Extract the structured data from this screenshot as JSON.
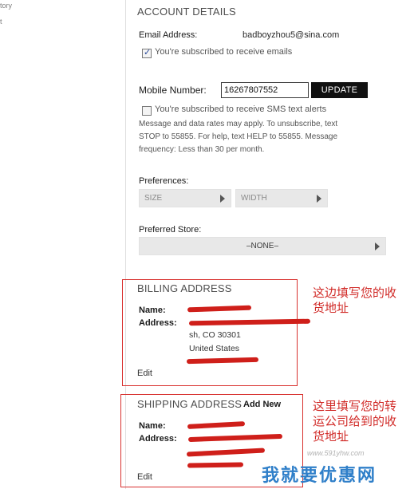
{
  "sidebar": {
    "items": [
      "tory",
      "t"
    ]
  },
  "account": {
    "title": "ACCOUNT DETAILS",
    "email_label": "Email Address:",
    "email_value": "badboyzhou5@sina.com",
    "email_subscribe": "You're subscribed to receive emails",
    "email_subscribed": true,
    "mobile_label": "Mobile Number:",
    "mobile_value": "16267807552",
    "update_label": "UPDATE",
    "sms_subscribe": "You're subscribed to receive SMS text alerts",
    "sms_subscribed": false,
    "sms_notice_1": "Message and data rates may apply. To unsubscribe, text",
    "sms_notice_2": "STOP to 55855. For help, text HELP to 55855. Message",
    "sms_notice_3": "frequency: Less than 30 per month.",
    "preferences_label": "Preferences:",
    "size_option": "SIZE",
    "width_option": "WIDTH",
    "preferred_store_label": "Preferred Store:",
    "store_option": "–NONE–"
  },
  "billing": {
    "title": "BILLING ADDRESS",
    "name_label": "Name:",
    "address_label": "Address:",
    "city_line": "sh, CO 30301",
    "country_line": "United States",
    "edit_label": "Edit",
    "note_line_1": "这边填写您的收",
    "note_line_2": "货地址"
  },
  "shipping": {
    "title": "SHIPPING ADDRESS",
    "add_new_label": "Add New",
    "name_label": "Name:",
    "address_label": "Address:",
    "edit_label": "Edit",
    "note_line_1": "这里填写您的转",
    "note_line_2": "运公司给到的收",
    "note_line_3": "货地址"
  },
  "watermark": {
    "text": "我就要优惠网",
    "url": "www.591yhw.com"
  },
  "colors": {
    "annotation_red": "#d12b28",
    "button_black": "#111111",
    "watermark_blue": "#2f7fc9"
  }
}
